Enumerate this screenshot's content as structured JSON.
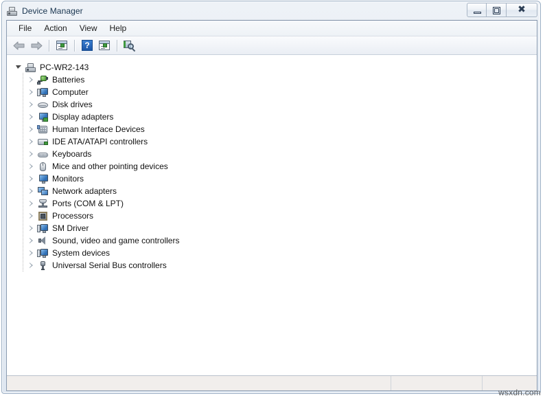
{
  "window": {
    "title": "Device Manager",
    "icon": "device-manager-icon",
    "buttons": {
      "minimize": "minimize",
      "maximize": "maximize",
      "close": "close"
    }
  },
  "menu": {
    "items": [
      {
        "label": "File"
      },
      {
        "label": "Action"
      },
      {
        "label": "View"
      },
      {
        "label": "Help"
      }
    ]
  },
  "toolbar": {
    "buttons": [
      {
        "name": "back-button",
        "icon": "back-arrow-icon"
      },
      {
        "name": "forward-button",
        "icon": "forward-arrow-icon"
      },
      {
        "name": "properties-button",
        "icon": "properties-icon"
      },
      {
        "name": "help-button",
        "icon": "help-icon"
      },
      {
        "name": "update-driver-button",
        "icon": "update-driver-icon"
      },
      {
        "name": "scan-hardware-changes-button",
        "icon": "scan-hardware-icon"
      }
    ]
  },
  "tree": {
    "root": {
      "label": "PC-WR2-143",
      "icon": "computer-icon",
      "expanded": true
    },
    "nodes": [
      {
        "label": "Batteries",
        "icon": "battery-icon"
      },
      {
        "label": "Computer",
        "icon": "computer-monitor-icon"
      },
      {
        "label": "Disk drives",
        "icon": "disk-drive-icon"
      },
      {
        "label": "Display adapters",
        "icon": "display-adapter-icon"
      },
      {
        "label": "Human Interface Devices",
        "icon": "hid-icon"
      },
      {
        "label": "IDE ATA/ATAPI controllers",
        "icon": "ide-controller-icon"
      },
      {
        "label": "Keyboards",
        "icon": "keyboard-icon"
      },
      {
        "label": "Mice and other pointing devices",
        "icon": "mouse-icon"
      },
      {
        "label": "Monitors",
        "icon": "monitor-icon"
      },
      {
        "label": "Network adapters",
        "icon": "network-adapter-icon"
      },
      {
        "label": "Ports (COM & LPT)",
        "icon": "port-icon"
      },
      {
        "label": "Processors",
        "icon": "processor-icon"
      },
      {
        "label": "SM Driver",
        "icon": "sm-driver-icon"
      },
      {
        "label": "Sound, video and game controllers",
        "icon": "sound-icon"
      },
      {
        "label": "System devices",
        "icon": "system-device-icon"
      },
      {
        "label": "Universal Serial Bus controllers",
        "icon": "usb-icon"
      }
    ]
  },
  "status_bar": {
    "pane1": "",
    "pane2": "",
    "pane3": ""
  },
  "watermark": {
    "text": "wsxdn.com"
  },
  "colors": {
    "title_text": "#17334e",
    "window_border": "#9aaec4",
    "client_bg": "#ffffff",
    "status_bg": "#f1eeec"
  }
}
